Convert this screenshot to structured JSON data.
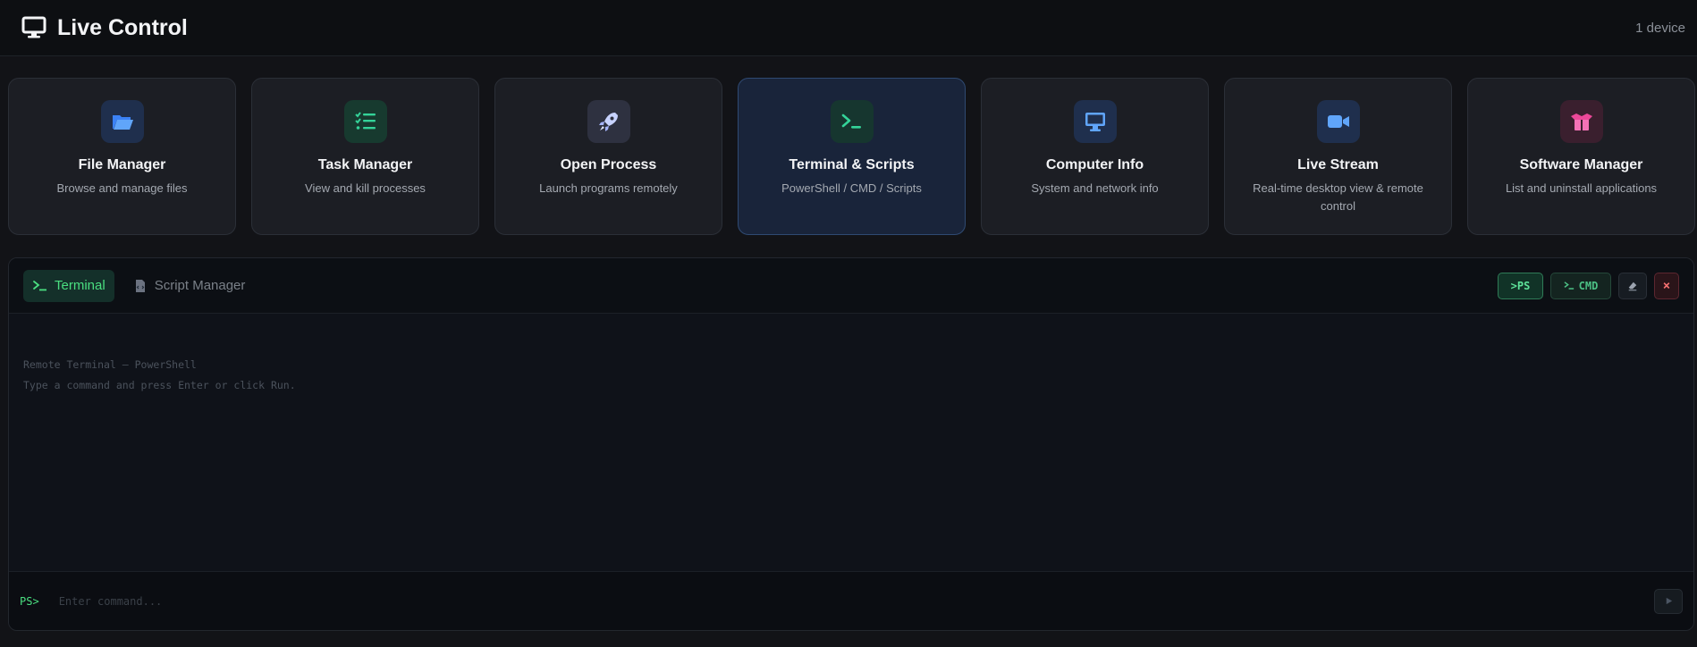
{
  "header": {
    "title": "Live Control",
    "device_count": "1 device"
  },
  "cards": [
    {
      "title": "File Manager",
      "desc": "Browse and manage files",
      "icon": "folder-open-icon",
      "color": "#60a5fa"
    },
    {
      "title": "Task Manager",
      "desc": "View and kill processes",
      "icon": "list-check-icon",
      "color": "#34d399"
    },
    {
      "title": "Open Process",
      "desc": "Launch programs remotely",
      "icon": "rocket-icon",
      "color": "#a5b4fc"
    },
    {
      "title": "Terminal & Scripts",
      "desc": "PowerShell / CMD / Scripts",
      "icon": "terminal-icon",
      "color": "#34d399"
    },
    {
      "title": "Computer Info",
      "desc": "System and network info",
      "icon": "monitor-icon",
      "color": "#60a5fa"
    },
    {
      "title": "Live Stream",
      "desc": "Real-time desktop view & remote control",
      "icon": "video-camera-icon",
      "color": "#60a5fa"
    },
    {
      "title": "Software Manager",
      "desc": "List and uninstall applications",
      "icon": "box-open-icon",
      "color": "#f472b6"
    }
  ],
  "terminal": {
    "tabs": [
      {
        "label": "Terminal",
        "icon": "terminal-icon"
      },
      {
        "label": "Script Manager",
        "icon": "file-code-icon"
      }
    ],
    "buttons": {
      "ps": ">PS",
      "cmd": "CMD",
      "close": "×"
    },
    "lines": [
      "Remote Terminal — PowerShell",
      "Type a command and press Enter or click Run."
    ],
    "prompt": "PS>",
    "input_placeholder": "Enter command..."
  }
}
